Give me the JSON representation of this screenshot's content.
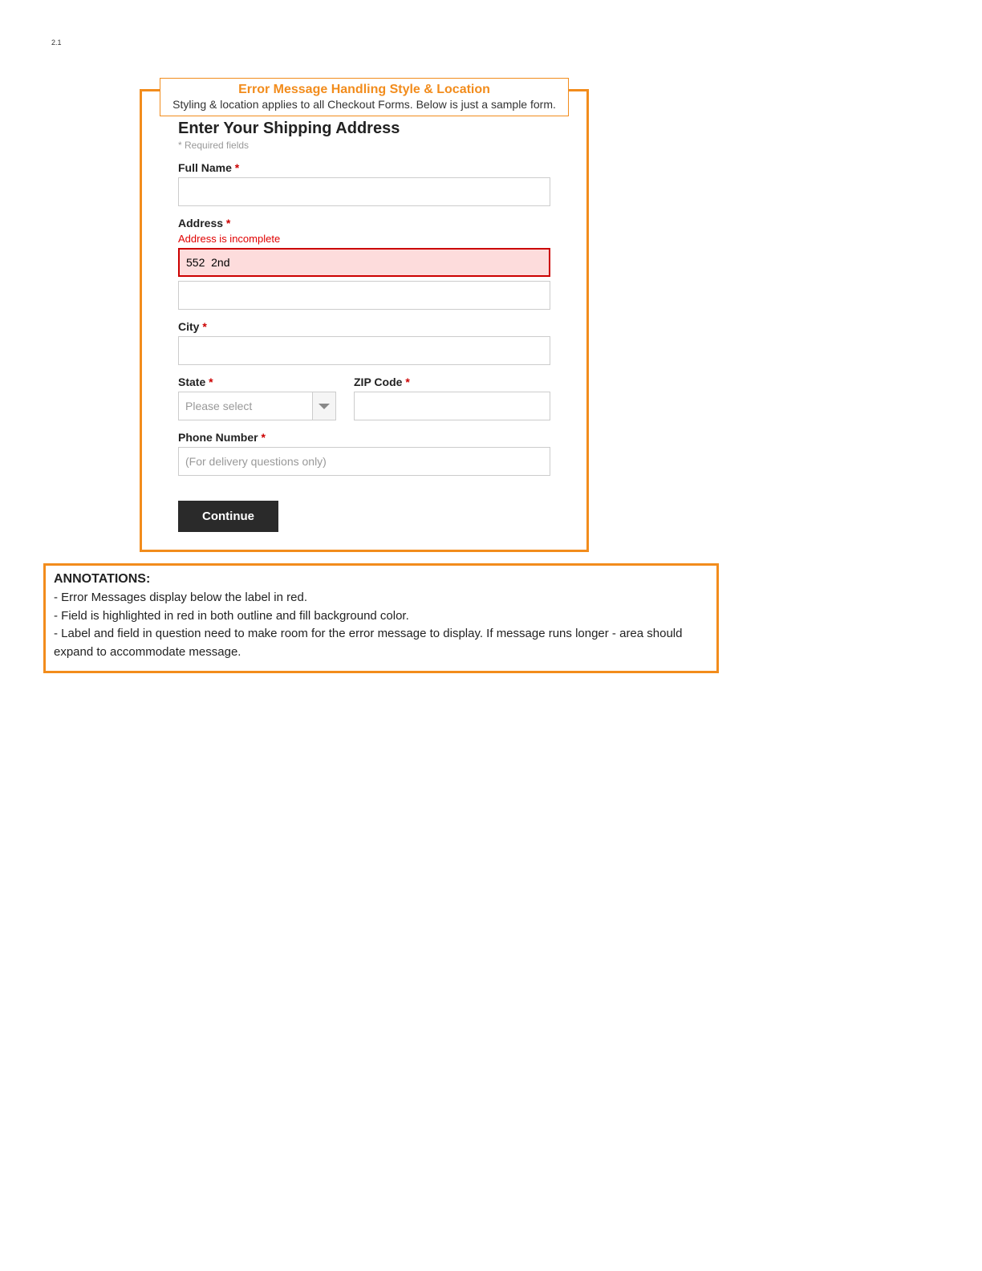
{
  "page_number": "2.1",
  "header": {
    "title": "Error Message Handling Style & Location",
    "subtitle": "Styling & location applies to all Checkout Forms. Below is just a sample form."
  },
  "form": {
    "title": "Enter Your Shipping Address",
    "required_note": "* Required fields",
    "full_name": {
      "label": "Full Name ",
      "value": ""
    },
    "address": {
      "label": "Address ",
      "error": "Address is incomplete",
      "line1_value": "552  2nd",
      "line2_value": ""
    },
    "city": {
      "label": "City ",
      "value": ""
    },
    "state": {
      "label": "State ",
      "placeholder": "Please select"
    },
    "zip": {
      "label": "ZIP Code ",
      "value": ""
    },
    "phone": {
      "label": "Phone Number ",
      "placeholder": "(For delivery questions only)",
      "value": ""
    },
    "continue_label": "Continue"
  },
  "annotations": {
    "title": "ANNOTATIONS:",
    "lines": [
      "- Error Messages display below the label in red.",
      "- Field is highlighted in red in both outline and fill background color.",
      "- Label and field in question need to make room for the error message to display. If message runs longer - area should expand to accommodate message."
    ]
  }
}
